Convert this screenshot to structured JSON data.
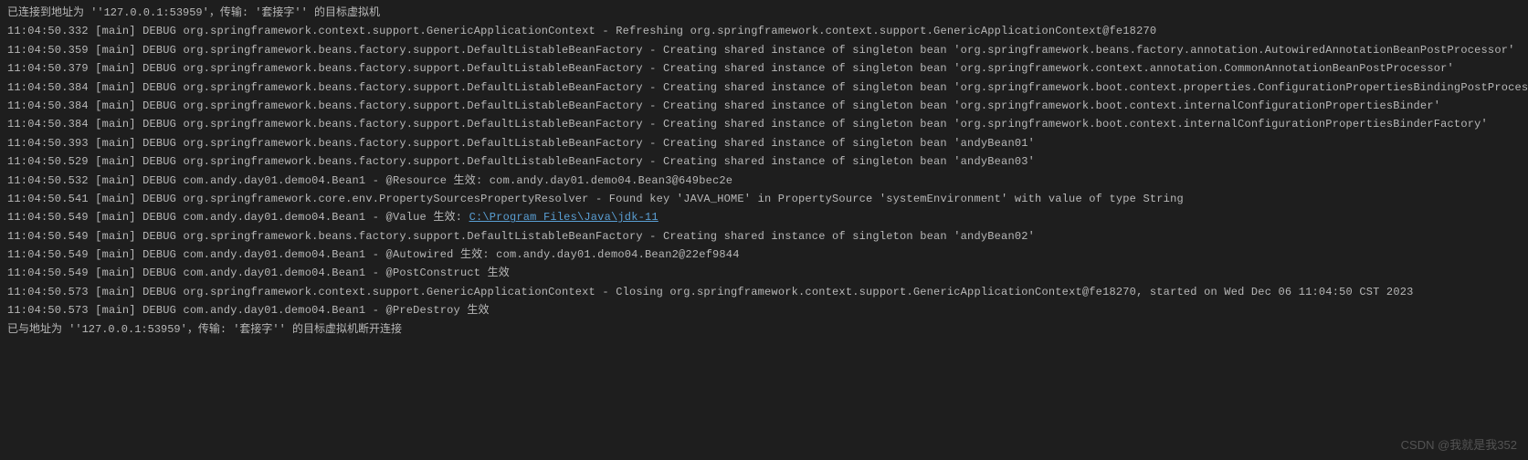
{
  "connection": {
    "connected": "已连接到地址为 ''127.0.0.1:53959'，传输: '套接字'' 的目标虚拟机",
    "disconnected": "已与地址为 ''127.0.0.1:53959'，传输: '套接字'' 的目标虚拟机断开连接"
  },
  "logs": [
    {
      "time": "11:04:50.332",
      "thread": "[main]",
      "level": "DEBUG",
      "logger": "org.springframework.context.support.GenericApplicationContext",
      "msg": "Refreshing org.springframework.context.support.GenericApplicationContext@fe18270"
    },
    {
      "time": "11:04:50.359",
      "thread": "[main]",
      "level": "DEBUG",
      "logger": "org.springframework.beans.factory.support.DefaultListableBeanFactory",
      "msg": "Creating shared instance of singleton bean 'org.springframework.beans.factory.annotation.AutowiredAnnotationBeanPostProcessor'"
    },
    {
      "time": "11:04:50.379",
      "thread": "[main]",
      "level": "DEBUG",
      "logger": "org.springframework.beans.factory.support.DefaultListableBeanFactory",
      "msg": "Creating shared instance of singleton bean 'org.springframework.context.annotation.CommonAnnotationBeanPostProcessor'"
    },
    {
      "time": "11:04:50.384",
      "thread": "[main]",
      "level": "DEBUG",
      "logger": "org.springframework.beans.factory.support.DefaultListableBeanFactory",
      "msg": "Creating shared instance of singleton bean 'org.springframework.boot.context.properties.ConfigurationPropertiesBindingPostProcessor'"
    },
    {
      "time": "11:04:50.384",
      "thread": "[main]",
      "level": "DEBUG",
      "logger": "org.springframework.beans.factory.support.DefaultListableBeanFactory",
      "msg": "Creating shared instance of singleton bean 'org.springframework.boot.context.internalConfigurationPropertiesBinder'"
    },
    {
      "time": "11:04:50.384",
      "thread": "[main]",
      "level": "DEBUG",
      "logger": "org.springframework.beans.factory.support.DefaultListableBeanFactory",
      "msg": "Creating shared instance of singleton bean 'org.springframework.boot.context.internalConfigurationPropertiesBinderFactory'"
    },
    {
      "time": "11:04:50.393",
      "thread": "[main]",
      "level": "DEBUG",
      "logger": "org.springframework.beans.factory.support.DefaultListableBeanFactory",
      "msg": "Creating shared instance of singleton bean 'andyBean01'"
    },
    {
      "time": "11:04:50.529",
      "thread": "[main]",
      "level": "DEBUG",
      "logger": "org.springframework.beans.factory.support.DefaultListableBeanFactory",
      "msg": "Creating shared instance of singleton bean 'andyBean03'"
    },
    {
      "time": "11:04:50.532",
      "thread": "[main]",
      "level": "DEBUG",
      "logger": "com.andy.day01.demo04.Bean1",
      "msg": "@Resource 生效: com.andy.day01.demo04.Bean3@649bec2e"
    },
    {
      "time": "11:04:50.541",
      "thread": "[main]",
      "level": "DEBUG",
      "logger": "org.springframework.core.env.PropertySourcesPropertyResolver",
      "msg": "Found key 'JAVA_HOME' in PropertySource 'systemEnvironment' with value of type String"
    },
    {
      "time": "11:04:50.549",
      "thread": "[main]",
      "level": "DEBUG",
      "logger": "com.andy.day01.demo04.Bean1",
      "msg_prefix": "@Value 生效: ",
      "link": "C:\\Program Files\\Java\\jdk-11",
      "has_link": true
    },
    {
      "time": "11:04:50.549",
      "thread": "[main]",
      "level": "DEBUG",
      "logger": "org.springframework.beans.factory.support.DefaultListableBeanFactory",
      "msg": "Creating shared instance of singleton bean 'andyBean02'"
    },
    {
      "time": "11:04:50.549",
      "thread": "[main]",
      "level": "DEBUG",
      "logger": "com.andy.day01.demo04.Bean1",
      "msg": "@Autowired 生效: com.andy.day01.demo04.Bean2@22ef9844"
    },
    {
      "time": "11:04:50.549",
      "thread": "[main]",
      "level": "DEBUG",
      "logger": "com.andy.day01.demo04.Bean1",
      "msg": "@PostConstruct 生效"
    },
    {
      "time": "11:04:50.573",
      "thread": "[main]",
      "level": "DEBUG",
      "logger": "org.springframework.context.support.GenericApplicationContext",
      "msg": "Closing org.springframework.context.support.GenericApplicationContext@fe18270, started on Wed Dec 06 11:04:50 CST 2023"
    },
    {
      "time": "11:04:50.573",
      "thread": "[main]",
      "level": "DEBUG",
      "logger": "com.andy.day01.demo04.Bean1",
      "msg": "@PreDestroy 生效"
    }
  ],
  "watermark": "CSDN @我就是我352"
}
